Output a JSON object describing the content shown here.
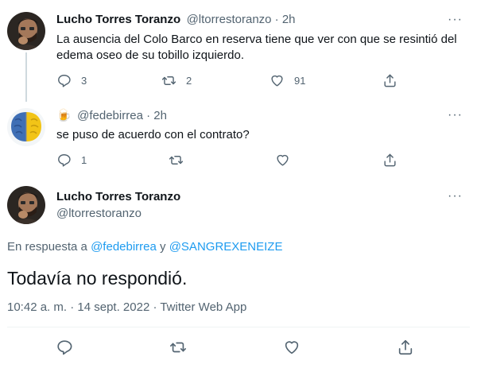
{
  "tweets": [
    {
      "display_name": "Lucho Torres Toranzo",
      "handle_time": "@ltorrestoranzo · 2h",
      "text": "La ausencia del Colo Barco en reserva tiene que ver con que se resintió del edema oseo de su tobillo izquierdo.",
      "reply_count": "3",
      "retweet_count": "2",
      "like_count": "91"
    },
    {
      "display_emoji": "🍺",
      "handle_time": "@fedebirrea · 2h",
      "text": "se puso de acuerdo con el contrato?",
      "reply_count": "1",
      "retweet_count": "",
      "like_count": ""
    }
  ],
  "main_tweet": {
    "display_name": "Lucho Torres Toranzo",
    "handle": "@ltorrestoranzo",
    "reply_prefix": "En respuesta a ",
    "reply_user1": "@fedebirrea",
    "reply_and": " y ",
    "reply_user2": "@SANGREXENEIZE",
    "text": "Todavía no respondió.",
    "meta": "10:42 a. m. · 14 sept. 2022 · Twitter Web App"
  },
  "icons": {
    "reply": "reply-icon",
    "retweet": "retweet-icon",
    "like": "heart-icon",
    "share": "share-icon",
    "more": "more-icon",
    "more_glyph": "···"
  },
  "colors": {
    "link": "#1d9bf0",
    "secondary_text": "#536471",
    "thread_line": "#cfd9de"
  }
}
